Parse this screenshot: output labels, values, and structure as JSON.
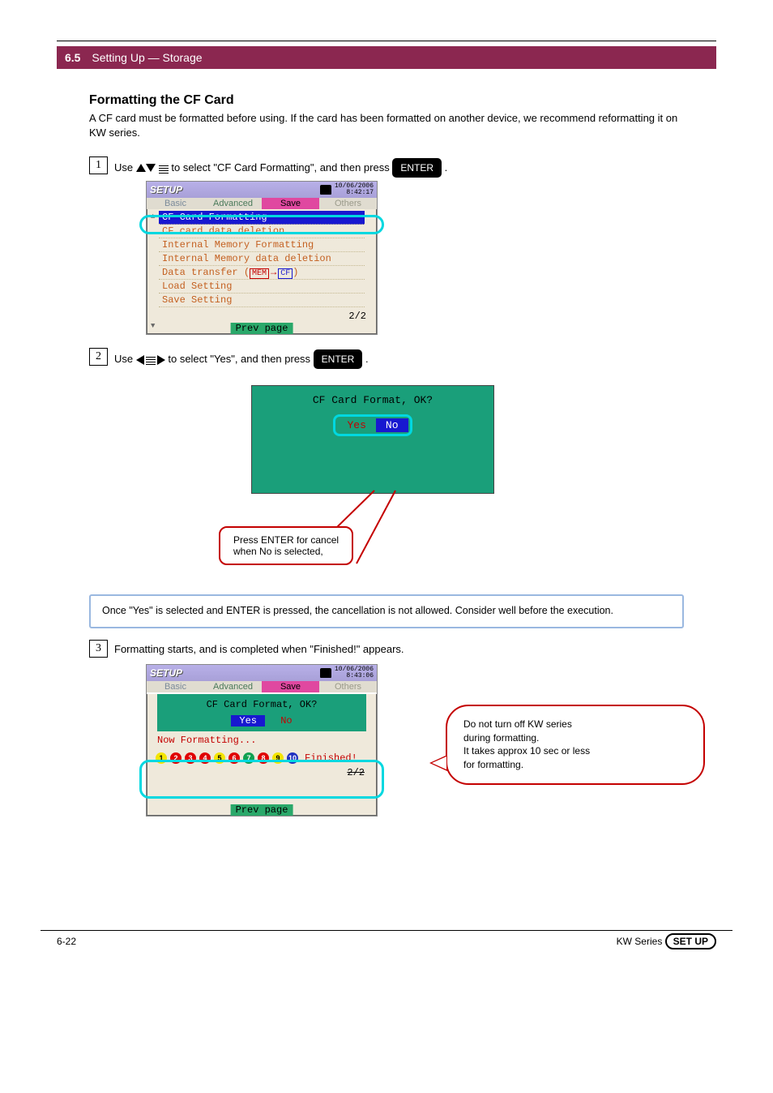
{
  "bar": {
    "num": "6.5",
    "title": "Setting Up — Storage"
  },
  "section": {
    "title": "Formatting the CF Card",
    "desc": "A CF card must be formatted before using. If the card has been formatted on another device, we recommend reformatting it on KW series."
  },
  "step1": {
    "pre": "Use ",
    "mid": " to select \"CF Card Formatting\", and then press ",
    "btn": "ENTER",
    "post": "."
  },
  "screen1": {
    "title": "SETUP",
    "date": "10/06/2006",
    "time": "8:42:17",
    "tabs": {
      "basic": "Basic",
      "advanced": "Advanced",
      "save": "Save",
      "others": "Others"
    },
    "items": [
      "CF Card Formatting",
      "CF card data deletion",
      "Internal Memory Formatting",
      "Internal Memory data deletion",
      "Data transfer",
      "Load Setting",
      "Save Setting"
    ],
    "mem": "MEM",
    "cf": "CF",
    "page": "2/2",
    "prev": "Prev page"
  },
  "step2": {
    "pre": "Use ",
    "mid": " to select \"Yes\", and then press ",
    "btn": "ENTER",
    "post": "."
  },
  "dialog1": {
    "title": "CF Card Format, OK?",
    "yes": "Yes",
    "no": "No"
  },
  "callout1": {
    "line1": "Press ENTER for cancel",
    "line2": "when No is selected,"
  },
  "infobox": "Once \"Yes\" is selected and ENTER is pressed, the cancellation is not allowed. Consider well before the execution.",
  "step3": "Formatting starts, and is completed when \"Finished!\" appears.",
  "screen3": {
    "title": "SETUP",
    "date": "10/06/2006",
    "time": "8:43:06",
    "tabs": {
      "basic": "Basic",
      "advanced": "Advanced",
      "save": "Save",
      "others": "Others"
    },
    "panel_title": "CF Card Format, OK?",
    "yes": "Yes",
    "no": "No",
    "now": "Now Formatting...",
    "finished": "Finished!",
    "page": "2/2",
    "prev": "Prev page"
  },
  "bubble": {
    "l1": "Do not turn off KW series",
    "l2": "during formatting.",
    "l3": "It takes approx 10 sec or less",
    "l4": "for formatting."
  },
  "footer": {
    "page": "6-22",
    "text": "KW Series  ",
    "setup": "SET UP"
  },
  "circles": [
    {
      "n": "1",
      "bg": "#f4e400",
      "fg": "#000"
    },
    {
      "n": "2",
      "bg": "#e00000",
      "fg": "#fff"
    },
    {
      "n": "3",
      "bg": "#e00000",
      "fg": "#fff"
    },
    {
      "n": "4",
      "bg": "#e00000",
      "fg": "#fff"
    },
    {
      "n": "5",
      "bg": "#f4e400",
      "fg": "#000"
    },
    {
      "n": "6",
      "bg": "#e00000",
      "fg": "#fff"
    },
    {
      "n": "7",
      "bg": "#10a050",
      "fg": "#fff"
    },
    {
      "n": "8",
      "bg": "#e00000",
      "fg": "#fff"
    },
    {
      "n": "9",
      "bg": "#f4e400",
      "fg": "#000"
    },
    {
      "n": "10",
      "bg": "#2030c0",
      "fg": "#fff"
    }
  ]
}
